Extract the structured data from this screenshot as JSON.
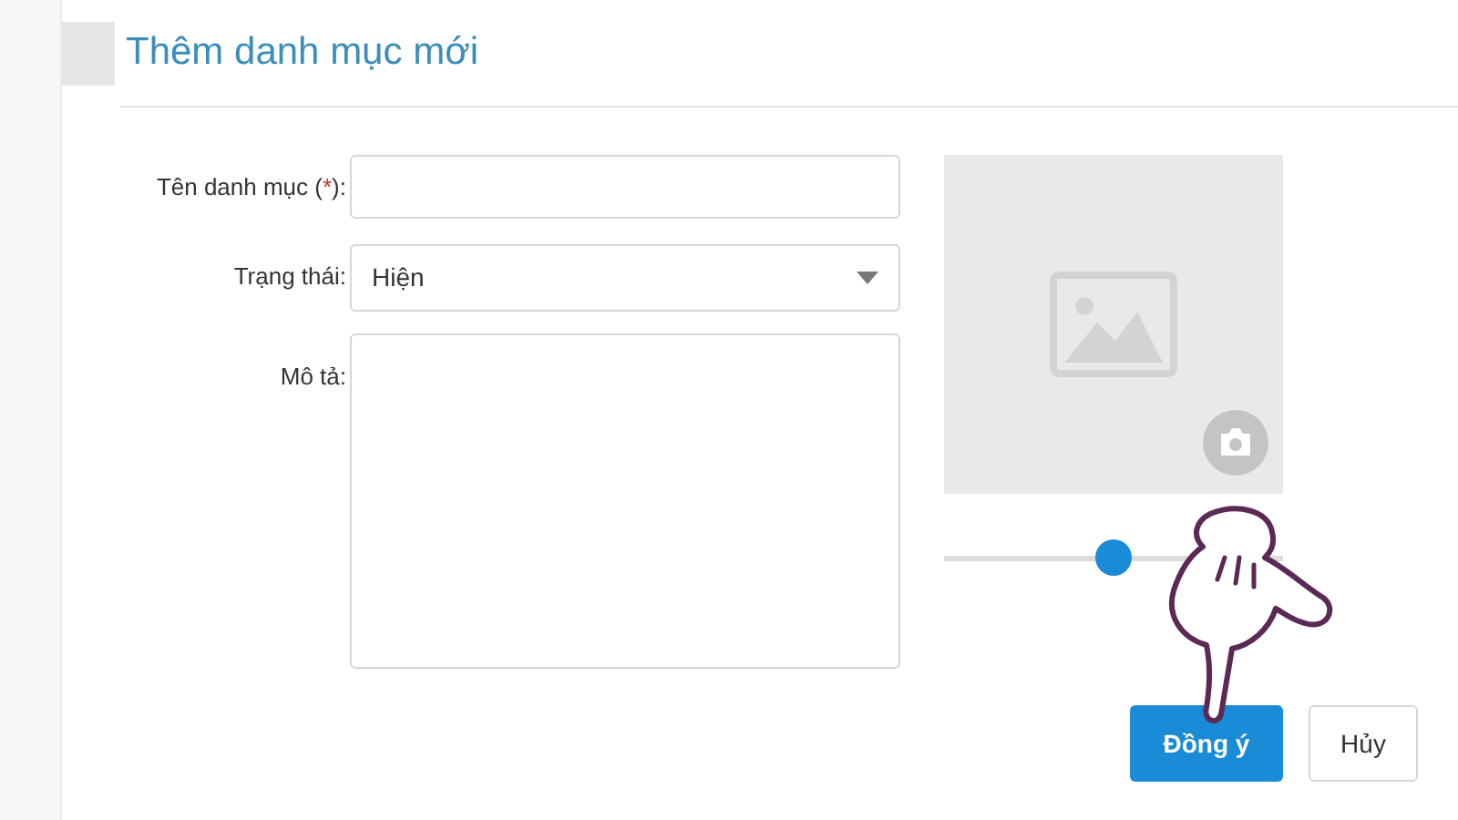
{
  "heading": "Thêm danh mục mới",
  "fields": [
    {
      "kind": "text",
      "label": "Tên danh mục (",
      "required_mark": "*",
      "label_end": "):"
    },
    {
      "kind": "select",
      "label": "Trạng thái:",
      "value": "Hiện"
    },
    {
      "kind": "textarea",
      "label": "Mô tả:"
    }
  ],
  "zoom_slider": {
    "level": 0.5
  },
  "buttons": [
    {
      "label": "Đồng ý",
      "primary": true
    },
    {
      "label": "Hủy",
      "primary": false
    }
  ]
}
